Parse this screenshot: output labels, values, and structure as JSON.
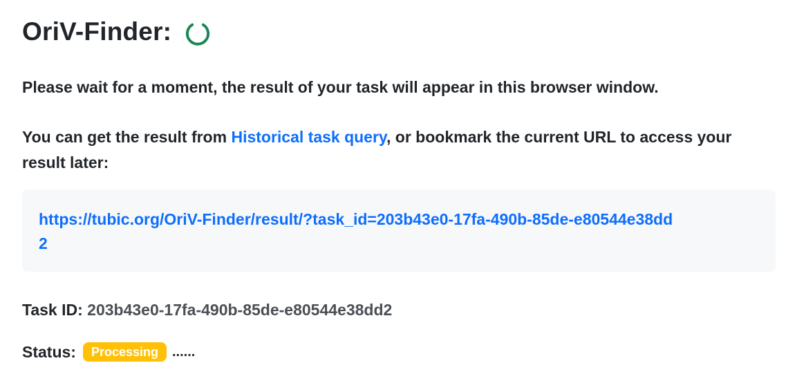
{
  "header": {
    "title": "OriV-Finder:",
    "spinner_icon": "loading-spinner-icon",
    "spinner_color": "#198754"
  },
  "messages": {
    "wait": "Please wait for a moment, the result of your task will appear in this browser window.",
    "query_prefix": "You can get the result from ",
    "query_link": "Historical task query",
    "query_suffix": ", or bookmark the current URL to access your result later:"
  },
  "result": {
    "url": "https://tubic.org/OriV-Finder/result/?task_id=203b43e0-17fa-490b-85de-e80544e38dd2"
  },
  "task": {
    "id_label": "Task ID:",
    "id_value": "203b43e0-17fa-490b-85de-e80544e38dd2",
    "status_label": "Status:",
    "status_value": "Processing",
    "status_color": "#ffc107",
    "status_suffix": "......"
  },
  "colors": {
    "link": "#0d6efd",
    "url_box_bg": "#f7f8fa",
    "text": "#212529"
  }
}
